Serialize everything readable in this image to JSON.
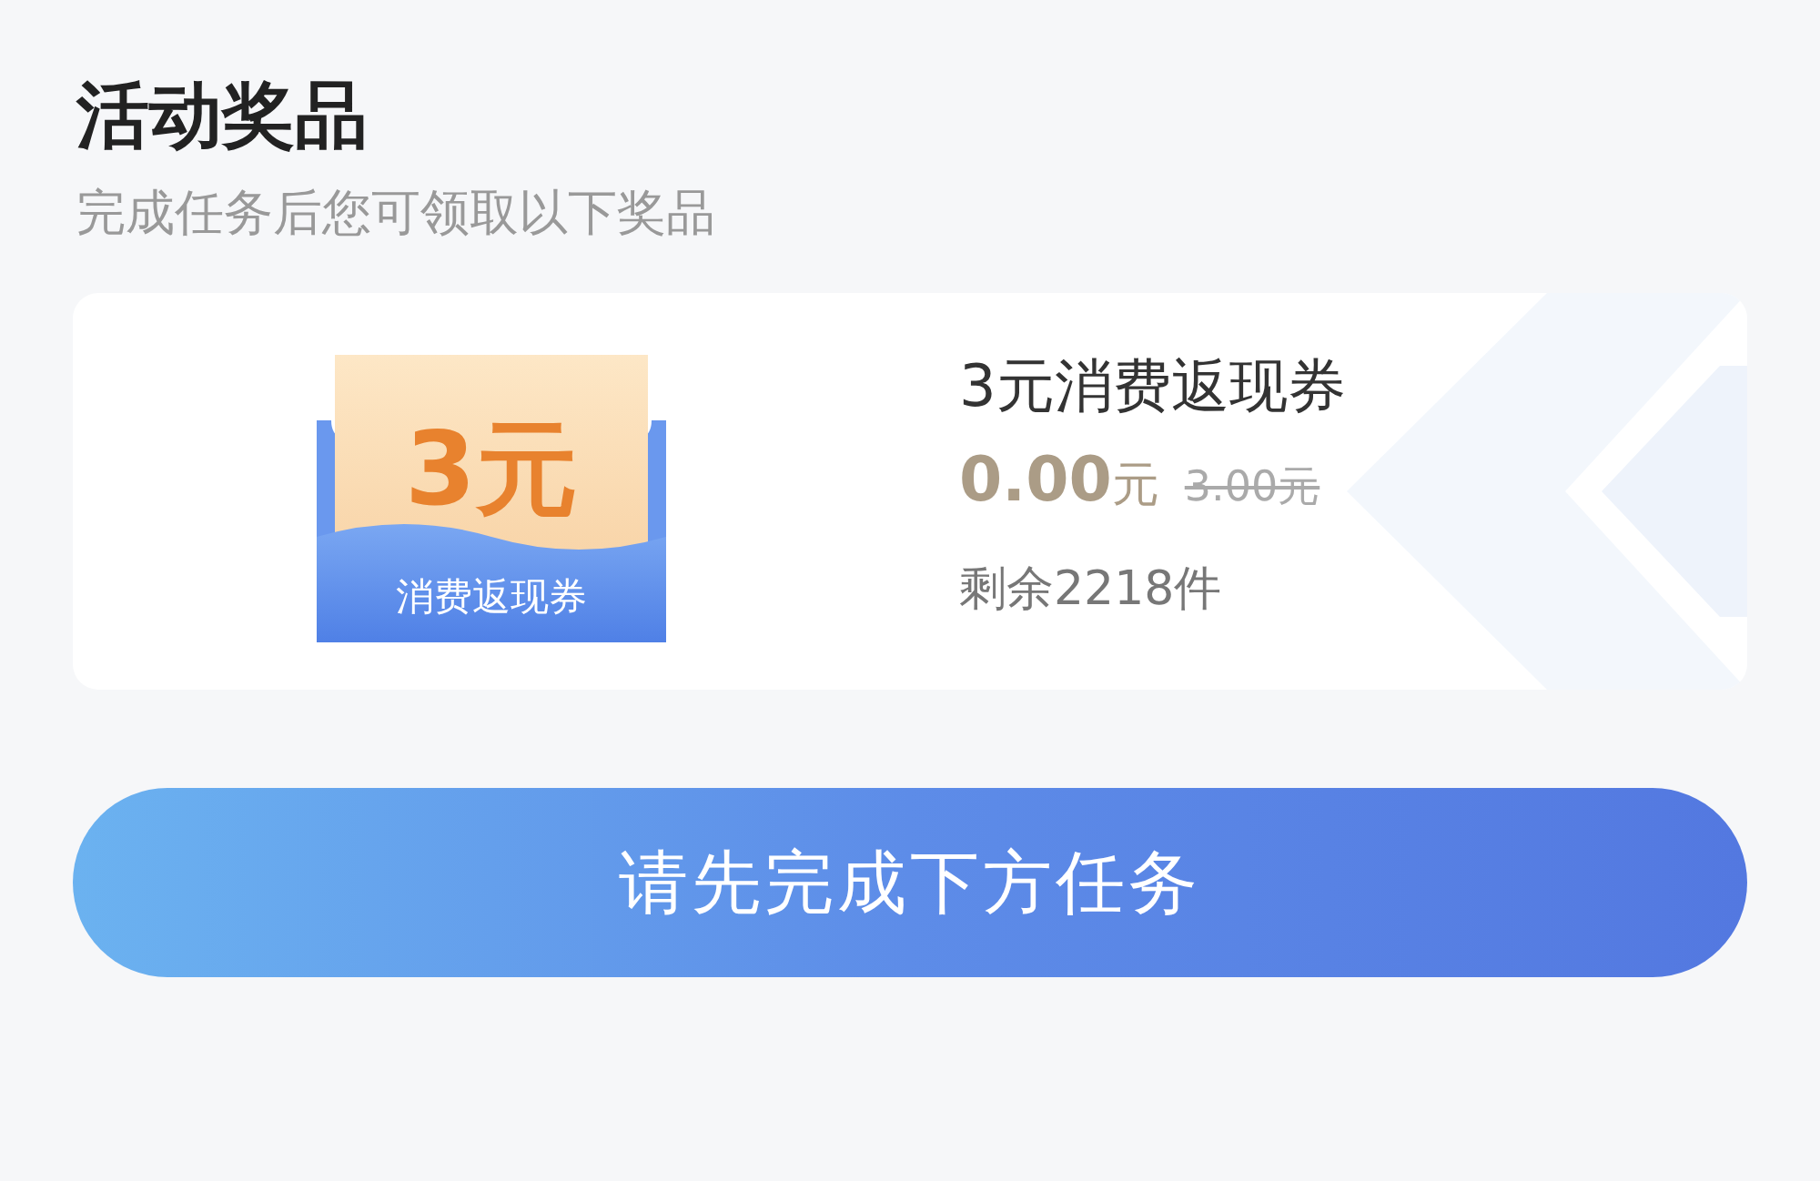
{
  "section": {
    "title": "活动奖品",
    "subtitle": "完成任务后您可领取以下奖品"
  },
  "prizes": [
    {
      "coupon_amount": "3元",
      "coupon_label": "消费返现券",
      "name": "3元消费返现券",
      "price": "0.00",
      "price_unit": "元",
      "original_price": "3.00元",
      "stock": "剩余2218件"
    }
  ],
  "action_button": {
    "label": "请先完成下方任务"
  }
}
